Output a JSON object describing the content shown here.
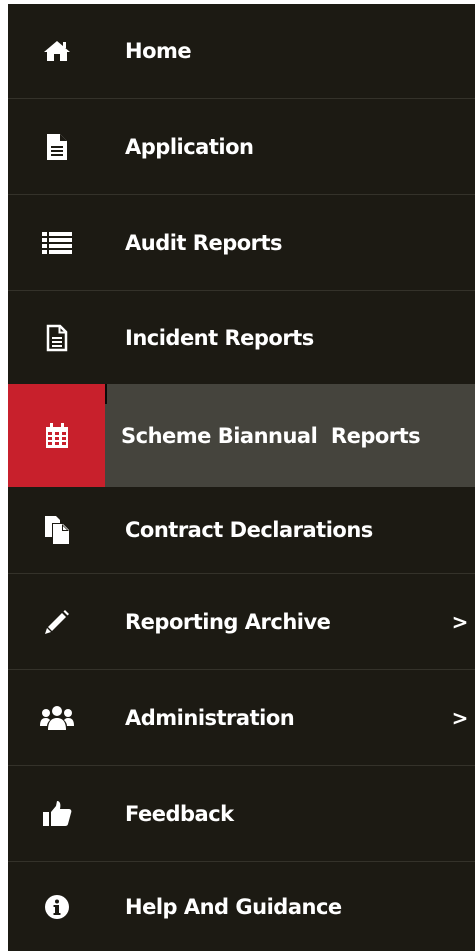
{
  "sidebar": {
    "items": [
      {
        "label": "Home",
        "icon": "home-icon"
      },
      {
        "label": "Application",
        "icon": "document-icon"
      },
      {
        "label": "Audit Reports",
        "icon": "list-icon"
      },
      {
        "label": "Incident Reports",
        "icon": "file-text-icon"
      },
      {
        "label": "Scheme Biannual  Reports",
        "icon": "calendar-icon",
        "active": true
      },
      {
        "label": "Contract Declarations",
        "icon": "files-icon"
      },
      {
        "label": "Reporting Archive",
        "icon": "pencil-icon",
        "submenu_indicator": ">"
      },
      {
        "label": "Administration",
        "icon": "users-icon",
        "submenu_indicator": ">"
      },
      {
        "label": "Feedback",
        "icon": "thumbs-up-icon"
      },
      {
        "label": "Help And Guidance",
        "icon": "info-icon"
      }
    ]
  },
  "colors": {
    "sidebar_background": "#1c1a13",
    "active_background": "#45443d",
    "active_icon_background": "#c8202c",
    "divider": "#34322a",
    "text": "#ffffff"
  }
}
